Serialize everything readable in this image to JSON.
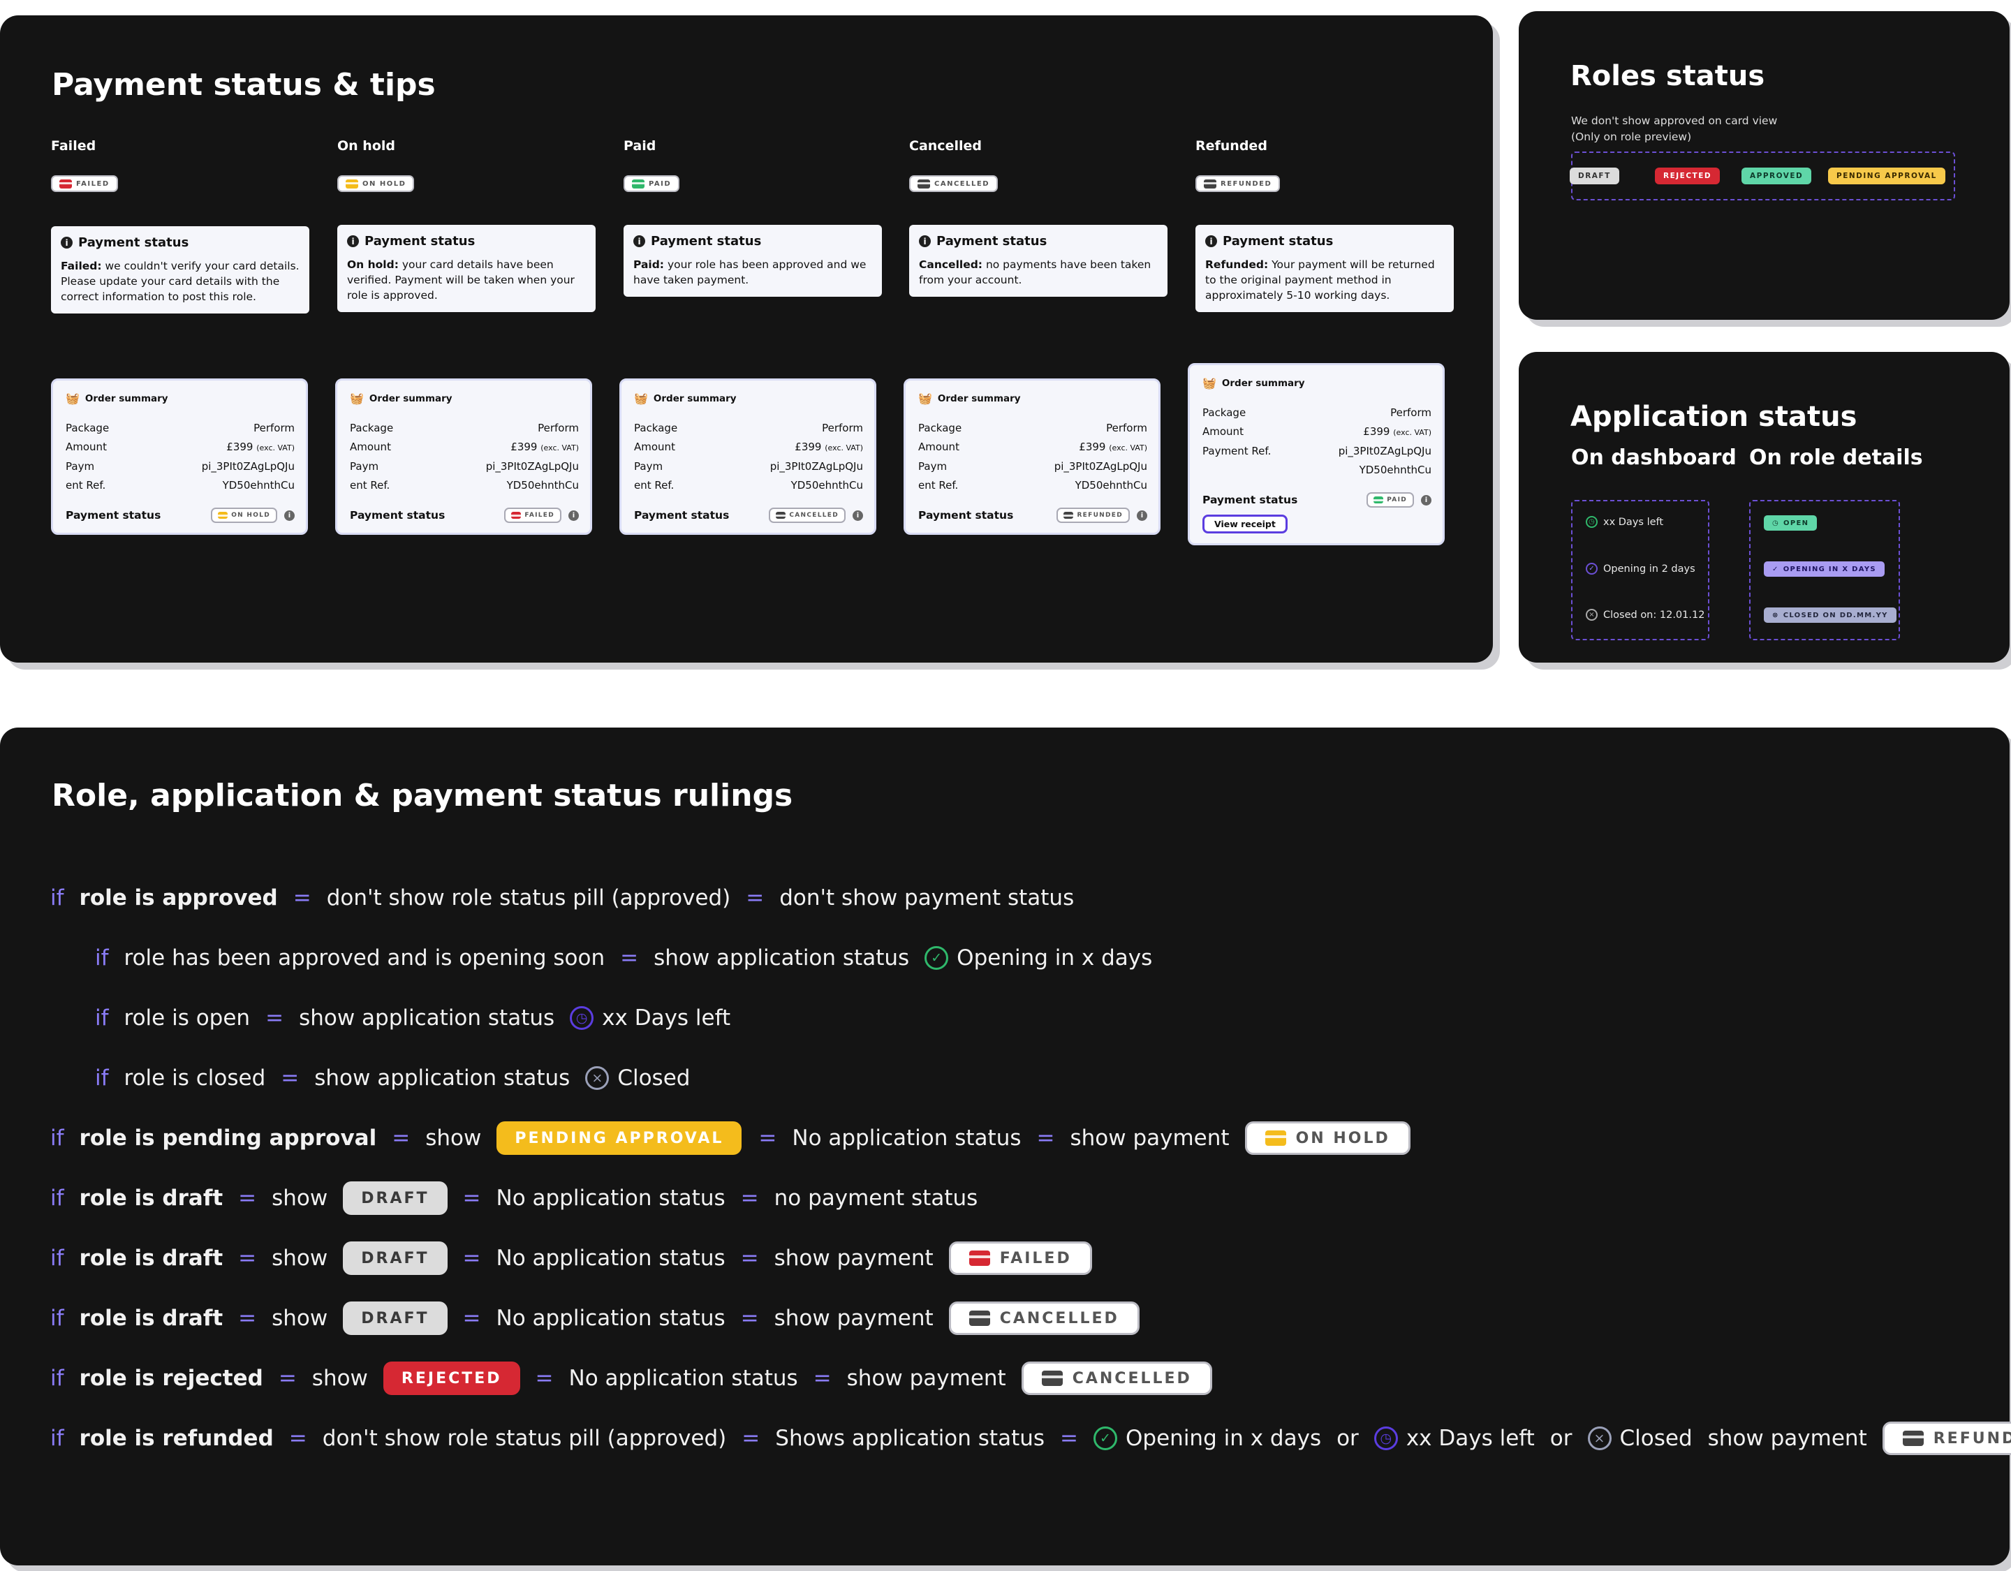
{
  "payment_panel": {
    "title": "Payment status & tips",
    "columns": [
      {
        "label": "Failed",
        "pill": "FAILED",
        "pill_color": "#d62833",
        "tip_heading": "Payment status",
        "tip_bold": "Failed:",
        "tip_text": " we couldn't verify your card details. Please update your card details with the correct information to post this role."
      },
      {
        "label": "On hold",
        "pill": "ON HOLD",
        "pill_color": "#f4bc1c",
        "tip_heading": "Payment status",
        "tip_bold": "On hold:",
        "tip_text": " your card details have been verified. Payment will be taken when your role is approved."
      },
      {
        "label": "Paid",
        "pill": "PAID",
        "pill_color": "#2fb86b",
        "tip_heading": "Payment status",
        "tip_bold": "Paid:",
        "tip_text": " your role has been approved and we have taken payment."
      },
      {
        "label": "Cancelled",
        "pill": "CANCELLED",
        "pill_color": "#444444",
        "tip_heading": "Payment status",
        "tip_bold": "Cancelled:",
        "tip_text": " no payments have been taken from your account."
      },
      {
        "label": "Refunded",
        "pill": "REFUNDED",
        "pill_color": "#444444",
        "tip_heading": "Payment status",
        "tip_bold": "Refunded:",
        "tip_text": " Your payment will be returned to the original payment method in approximately 5-10 working days."
      }
    ],
    "orders": [
      {
        "heading": "Order summary",
        "package_label": "Package",
        "package_value": "Perform",
        "amount_label": "Amount",
        "amount_value": "£399",
        "vat": "(exc. VAT)",
        "ref_label_1": "Paym",
        "ref_label_2": "ent Ref.",
        "ref_value_1": "pi_3PIt0ZAgLpQJu",
        "ref_value_2": "YD50ehnthCu",
        "status_label": "Payment status",
        "pill": "ON HOLD",
        "pill_color": "#f4bc1c"
      },
      {
        "heading": "Order summary",
        "package_label": "Package",
        "package_value": "Perform",
        "amount_label": "Amount",
        "amount_value": "£399",
        "vat": "(exc. VAT)",
        "ref_label_1": "Paym",
        "ref_label_2": "ent Ref.",
        "ref_value_1": "pi_3PIt0ZAgLpQJu",
        "ref_value_2": "YD50ehnthCu",
        "status_label": "Payment status",
        "pill": "FAILED",
        "pill_color": "#d62833"
      },
      {
        "heading": "Order summary",
        "package_label": "Package",
        "package_value": "Perform",
        "amount_label": "Amount",
        "amount_value": "£399",
        "vat": "(exc. VAT)",
        "ref_label_1": "Paym",
        "ref_label_2": "ent Ref.",
        "ref_value_1": "pi_3PIt0ZAgLpQJu",
        "ref_value_2": "YD50ehnthCu",
        "status_label": "Payment status",
        "pill": "CANCELLED",
        "pill_color": "#444444"
      },
      {
        "heading": "Order summary",
        "package_label": "Package",
        "package_value": "Perform",
        "amount_label": "Amount",
        "amount_value": "£399",
        "vat": "(exc. VAT)",
        "ref_label_1": "Paym",
        "ref_label_2": "ent Ref.",
        "ref_value_1": "pi_3PIt0ZAgLpQJu",
        "ref_value_2": "YD50ehnthCu",
        "status_label": "Payment status",
        "pill": "REFUNDED",
        "pill_color": "#444444"
      }
    ],
    "paid_order": {
      "heading": "Order summary",
      "package_label": "Package",
      "package_value": "Perform",
      "amount_label": "Amount",
      "amount_value": "£399",
      "vat": "(exc. VAT)",
      "ref_label": "Payment Ref.",
      "ref_value_1": "pi_3PIt0ZAgLpQJu",
      "ref_value_2": "YD50ehnthCu",
      "status_label": "Payment status",
      "pill": "PAID",
      "pill_color": "#2fb86b",
      "receipt": "View receipt"
    }
  },
  "roles_panel": {
    "title": "Roles status",
    "note_1": "We don't show approved on card view",
    "note_2": "(Only on role preview)",
    "pills": [
      {
        "label": "DRAFT",
        "bg": "#dcdcdc",
        "fg": "#333333"
      },
      {
        "label": "REJECTED",
        "bg": "#d62833",
        "fg": "#ffffff"
      },
      {
        "label": "APPROVED",
        "bg": "#5fd6a8",
        "fg": "#0f3b2b"
      },
      {
        "label": "PENDING APPROVAL",
        "bg": "#f7c94a",
        "fg": "#3a2a00"
      }
    ]
  },
  "application_panel": {
    "title": "Application status",
    "dashboard_label": "On dashboard",
    "details_label": "On role details",
    "dashboard_items": [
      "xx Days left",
      "Opening in 2 days",
      "Closed on: 12.01.12"
    ],
    "details_pills": [
      "OPEN",
      "OPENING IN X DAYS",
      "CLOSED ON DD.MM.YY"
    ]
  },
  "rulings": {
    "title": "Role, application & payment status rulings",
    "if_word": "if",
    "eq": "=",
    "r1": {
      "cond": "role is approved",
      "a": "don't show role status pill (approved)",
      "b": "don't show payment status"
    },
    "r2": {
      "cond": "role has been approved and is opening soon",
      "a": "show application status",
      "status": "Opening in x days"
    },
    "r3": {
      "cond": "role is open",
      "a": "show application status",
      "status": "xx Days left"
    },
    "r4": {
      "cond": "role is closed",
      "a": "show application status",
      "status": "Closed"
    },
    "r5": {
      "cond": "role is pending approval",
      "show": "show",
      "pill": "PENDING APPROVAL",
      "a": "No application status",
      "b": "show payment",
      "pay": "ON HOLD"
    },
    "r6": {
      "cond": "role is draft",
      "show": "show",
      "pill": "DRAFT",
      "a": "No application status",
      "b": "no payment status"
    },
    "r7": {
      "cond": "role is draft",
      "show": "show",
      "pill": "DRAFT",
      "a": "No application status",
      "b": "show payment",
      "pay": "FAILED"
    },
    "r8": {
      "cond": "role is draft",
      "show": "show",
      "pill": "DRAFT",
      "a": "No application status",
      "b": "show payment",
      "pay": "CANCELLED"
    },
    "r9": {
      "cond": "role is rejected",
      "show": "show",
      "pill": "REJECTED",
      "a": "No application status",
      "b": "show payment",
      "pay": "CANCELLED"
    },
    "r10": {
      "cond": "role is refunded",
      "a": "don't show role status pill (approved)",
      "b": "Shows application status",
      "s1": "Opening in x days",
      "or": "or",
      "s2": "xx Days left",
      "s3": "Closed",
      "c": "show payment",
      "pay": "REFUNDED"
    }
  }
}
